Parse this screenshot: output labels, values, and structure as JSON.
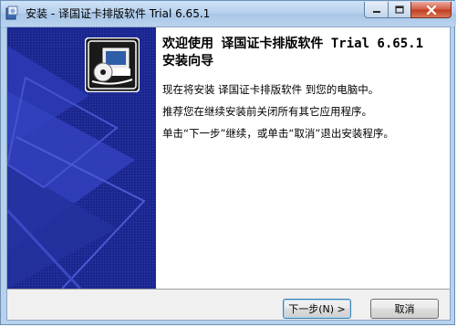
{
  "window": {
    "title": "安装 - 译国证卡排版软件 Trial 6.65.1"
  },
  "colors": {
    "side_panel": "#1e2a94",
    "titlebar": "#bcd5ef",
    "close_button": "#c3391f"
  },
  "wizard": {
    "heading": "欢迎使用 译国证卡排版软件 Trial 6.65.1 安装向导",
    "line1": "现在将安装 译国证卡排版软件 到您的电脑中。",
    "line2": "推荐您在继续安装前关闭所有其它应用程序。",
    "line3": "单击“下一步”继续，或单击“取消”退出安装程序。"
  },
  "buttons": {
    "next": "下一步(N) >",
    "cancel": "取消"
  },
  "icons": {
    "app": "installer-icon",
    "logo": "computer-disc-icon",
    "minimize": "minimize-icon",
    "maximize": "maximize-icon",
    "close": "close-icon"
  }
}
